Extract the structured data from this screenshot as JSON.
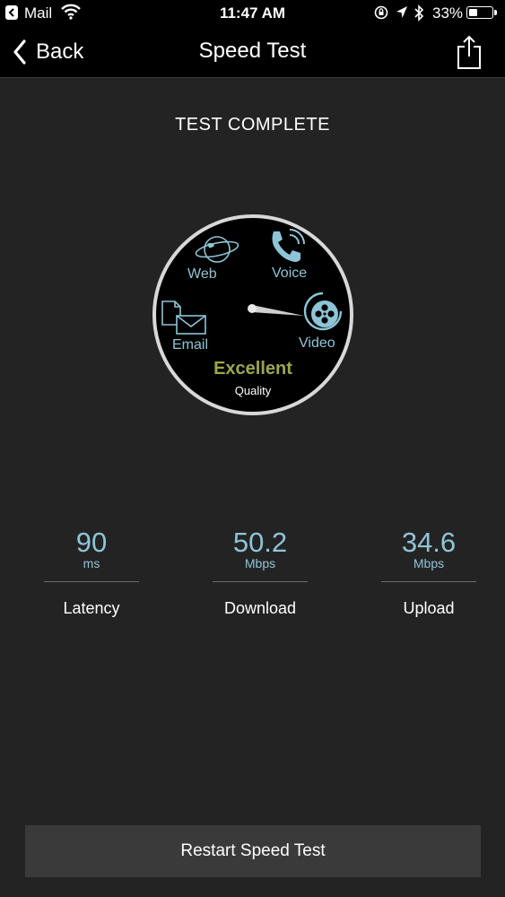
{
  "status_bar": {
    "back_app": "Mail",
    "time": "11:47 AM",
    "battery_percent": "33%",
    "battery_level": 0.33,
    "icons": [
      "back-to-app-icon",
      "wifi-icon",
      "orientation-lock-icon",
      "location-icon",
      "bluetooth-icon",
      "battery-icon"
    ]
  },
  "nav": {
    "back_label": "Back",
    "title": "Speed Test",
    "share_icon": "share-icon"
  },
  "main": {
    "status_heading": "TEST COMPLETE",
    "dial": {
      "labels": {
        "web": "Web",
        "voice": "Voice",
        "email": "Email",
        "video": "Video"
      },
      "quality_value": "Excellent",
      "quality_label": "Quality",
      "needle_target": "Video",
      "icons": [
        "globe-icon",
        "phone-icon",
        "email-icon",
        "video-reel-icon"
      ]
    },
    "metrics": [
      {
        "value": "90",
        "unit": "ms",
        "label": "Latency"
      },
      {
        "value": "50.2",
        "unit": "Mbps",
        "label": "Download"
      },
      {
        "value": "34.6",
        "unit": "Mbps",
        "label": "Upload"
      }
    ],
    "restart_label": "Restart Speed Test"
  },
  "colors": {
    "background": "#232324",
    "bar": "#000000",
    "accent_blue": "#8fc4d6",
    "quality_green": "#9ea64e",
    "button": "#3a3a3b"
  }
}
